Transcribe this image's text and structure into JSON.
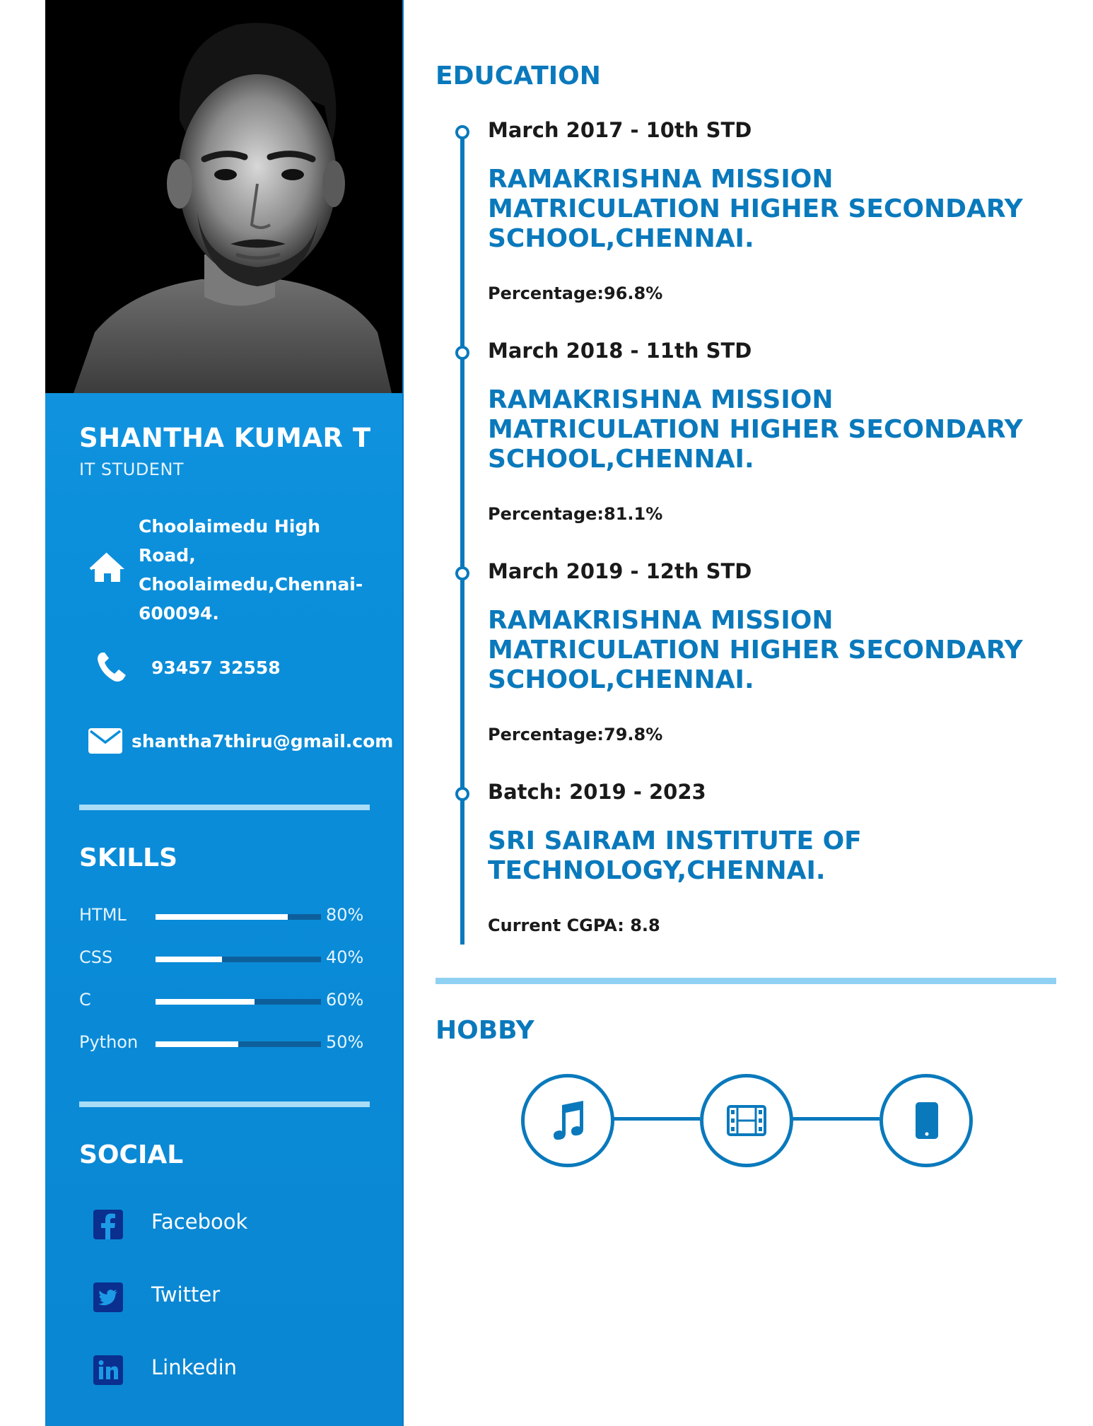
{
  "profile": {
    "name": "SHANTHA KUMAR T",
    "role": "IT STUDENT",
    "address": "Choolaimedu High Road, Choolaimedu,Chennai-600094.",
    "phone": "93457 32558",
    "email": "shantha7thiru@gmail.com"
  },
  "skills": {
    "heading": "SKILLS",
    "items": [
      {
        "name": "HTML",
        "percent": 80,
        "label": "80%"
      },
      {
        "name": "CSS",
        "percent": 40,
        "label": "40%"
      },
      {
        "name": "C",
        "percent": 60,
        "label": "60%"
      },
      {
        "name": "Python",
        "percent": 50,
        "label": "50%"
      }
    ]
  },
  "social": {
    "heading": "SOCIAL",
    "items": [
      {
        "label": "Facebook",
        "icon": "facebook-icon"
      },
      {
        "label": "Twitter",
        "icon": "twitter-icon"
      },
      {
        "label": "Linkedin",
        "icon": "linkedin-icon"
      }
    ]
  },
  "education": {
    "heading": "EDUCATION",
    "entries": [
      {
        "date": "March 2017 - 10th STD",
        "school": "RAMAKRISHNA MISSION MATRICULATION HIGHER SECONDARY SCHOOL,CHENNAI.",
        "score": "Percentage:96.8%"
      },
      {
        "date": "March 2018 - 11th STD",
        "school": "RAMAKRISHNA MISSION MATRICULATION HIGHER SECONDARY SCHOOL,CHENNAI.",
        "score": "Percentage:81.1%"
      },
      {
        "date": "March 2019 - 12th STD",
        "school": "RAMAKRISHNA MISSION MATRICULATION HIGHER SECONDARY SCHOOL,CHENNAI.",
        "score": "Percentage:79.8%"
      },
      {
        "date": "Batch: 2019 - 2023",
        "school": "SRI SAIRAM INSTITUTE OF TECHNOLOGY,CHENNAI.",
        "score": "Current CGPA: 8.8"
      }
    ]
  },
  "hobby": {
    "heading": "HOBBY",
    "icons": [
      "music-note-icon",
      "film-icon",
      "smartphone-icon"
    ]
  },
  "colors": {
    "sidebar_blue": "#0b8fdb",
    "accent_blue": "#0a79bc",
    "divider_light": "#a9dcf7"
  }
}
